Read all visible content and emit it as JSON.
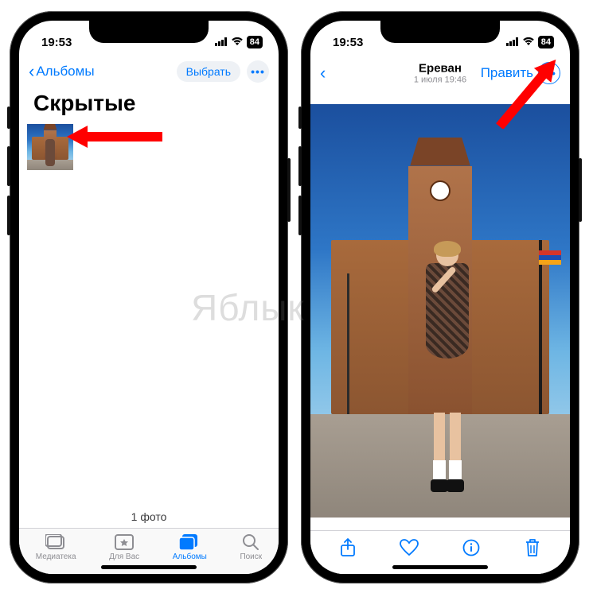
{
  "status": {
    "time": "19:53",
    "battery": "84"
  },
  "left": {
    "back_label": "Альбомы",
    "select_label": "Выбрать",
    "title": "Скрытые",
    "count_label": "1 фото",
    "tabs": [
      {
        "label": "Медиатека"
      },
      {
        "label": "Для Вас"
      },
      {
        "label": "Альбомы"
      },
      {
        "label": "Поиск"
      }
    ]
  },
  "right": {
    "title": "Ереван",
    "subtitle": "1 июля 19:46",
    "edit_label": "Править"
  },
  "watermark": "Яблык"
}
